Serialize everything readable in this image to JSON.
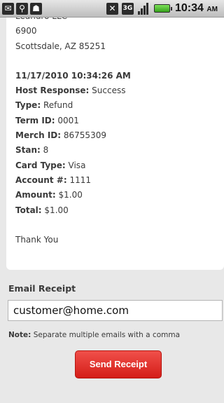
{
  "status_bar": {
    "network_label": "3G",
    "time": "10:34",
    "ampm": "AM",
    "icons": [
      "mail-icon",
      "usb-icon",
      "android-icon",
      "mute-icon",
      "3g-icon",
      "signal-icon",
      "battery-icon"
    ]
  },
  "receipt": {
    "company_cut": "Leandro LLC",
    "address1": "6900",
    "address2": "Scottsdale, AZ 85251",
    "datetime": "11/17/2010 10:34:26 AM",
    "fields": [
      {
        "label": "Host Response:",
        "value": "Success"
      },
      {
        "label": "Type:",
        "value": "Refund"
      },
      {
        "label": "Term ID:",
        "value": "0001"
      },
      {
        "label": "Merch ID:",
        "value": "86755309"
      },
      {
        "label": "Stan:",
        "value": "8"
      },
      {
        "label": "Card Type:",
        "value": "Visa"
      },
      {
        "label": "Account #:",
        "value": "1111"
      },
      {
        "label": "Amount:",
        "value": "$1.00"
      },
      {
        "label": "Total:",
        "value": "$1.00"
      }
    ],
    "footer": "Thank You"
  },
  "email": {
    "section_title": "Email Receipt",
    "value": "customer@home.com",
    "note_label": "Note:",
    "note_text": "Separate multiple emails with a comma",
    "send_label": "Send Receipt"
  },
  "colors": {
    "accent_red": "#d41d18",
    "background": "#e8e8e8"
  }
}
